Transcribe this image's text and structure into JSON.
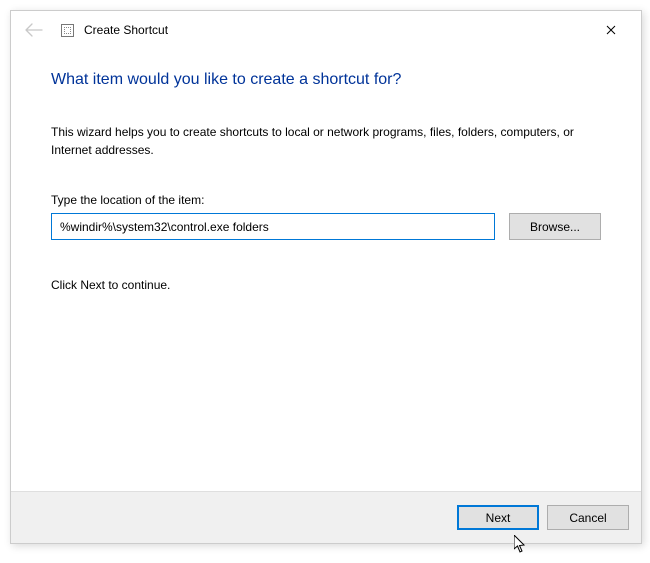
{
  "titlebar": {
    "title": "Create Shortcut"
  },
  "content": {
    "headline": "What item would you like to create a shortcut for?",
    "description": "This wizard helps you to create shortcuts to local or network programs, files, folders, computers, or Internet addresses.",
    "location_label": "Type the location of the item:",
    "location_value": "%windir%\\system32\\control.exe folders",
    "browse_label": "Browse...",
    "continue_text": "Click Next to continue."
  },
  "footer": {
    "next_label": "Next",
    "cancel_label": "Cancel"
  }
}
